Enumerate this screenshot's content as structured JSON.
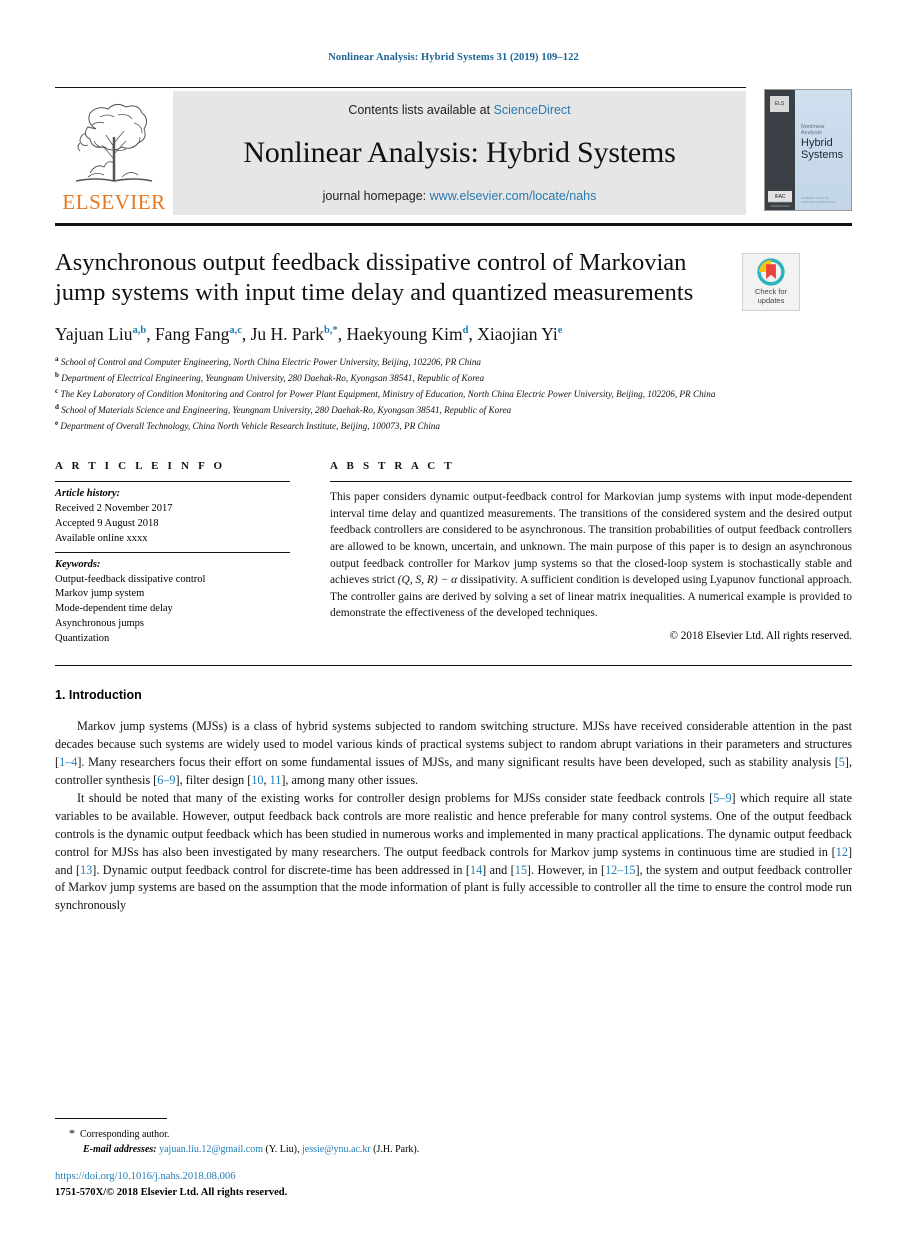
{
  "running_head": "Nonlinear Analysis: Hybrid Systems 31 (2019) 109–122",
  "masthead": {
    "publisher_word": "ELSEVIER",
    "contents_prefix": "Contents lists available at",
    "contents_link": "ScienceDirect",
    "journal_title": "Nonlinear Analysis: Hybrid Systems",
    "homepage_prefix": "journal homepage:",
    "homepage_link": "www.elsevier.com/locate/nahs",
    "cover": {
      "elsevier_mark": "ELS",
      "ifac_mark": "IFAC",
      "ifac_sub": "INTERNATIONAL FEDERATION",
      "superline": "Nonlinear Analysis",
      "title_line1": "Hybrid",
      "title_line2": "Systems",
      "bottom_note": "Available online at www.sciencedirect.com"
    }
  },
  "article": {
    "title": "Asynchronous output feedback dissipative control of Markovian jump systems with input time delay and quantized measurements",
    "crossmark_label_line1": "Check for",
    "crossmark_label_line2": "updates",
    "authors": [
      {
        "name": "Yajuan Liu",
        "marks": "a,b"
      },
      {
        "name": "Fang Fang",
        "marks": "a,c"
      },
      {
        "name": "Ju H. Park",
        "marks": "b,*"
      },
      {
        "name": "Haekyoung Kim",
        "marks": "d"
      },
      {
        "name": "Xiaojian Yi",
        "marks": "e"
      }
    ],
    "affiliations": [
      {
        "mark": "a",
        "text": "School of Control and Computer Engineering, North China Electric Power University, Beijing, 102206, PR China"
      },
      {
        "mark": "b",
        "text": "Department of Electrical Engineering, Yeungnam University, 280 Daehak-Ro, Kyongsan  38541, Republic of Korea"
      },
      {
        "mark": "c",
        "text": "The Key Laboratory of Condition Monitoring and Control for Power Plant Equipment, Ministry of Education, North China Electric Power University, Beijing, 102206, PR China"
      },
      {
        "mark": "d",
        "text": "School of Materials Science and Engineering, Yeungnam University, 280 Daehak-Ro, Kyongsan  38541, Republic of Korea"
      },
      {
        "mark": "e",
        "text": "Department of Overall Technology, China North Vehicle Research Institute, Beijing, 100073, PR China"
      }
    ]
  },
  "article_info": {
    "heading": "A R T I C L E   I N F O",
    "history_label": "Article history:",
    "history_lines": [
      "Received 2 November 2017",
      "Accepted 9 August 2018",
      "Available online xxxx"
    ],
    "keywords_label": "Keywords:",
    "keywords": [
      "Output-feedback dissipative control",
      "Markov jump system",
      "Mode-dependent time delay",
      "Asynchronous jumps",
      "Quantization"
    ]
  },
  "abstract": {
    "heading": "A B S T R A C T",
    "text_part1": "This paper considers dynamic output-feedback control for Markovian jump systems with input mode-dependent interval time delay and quantized measurements. The transitions of the considered system and the desired output feedback controllers are considered to be asynchronous. The transition probabilities of output feedback controllers are allowed to be known, uncertain, and unknown. The main purpose of this paper is to design an asynchronous output feedback controller for Markov jump systems so that the closed-loop system is stochastically stable and achieves strict ",
    "math_expr": "(Q, S, R) − α",
    "text_part2": " dissipativity. A sufficient condition is developed using Lyapunov functional approach. The controller gains are derived by solving a set of linear matrix inequalities. A numerical example is provided to demonstrate the effectiveness of the developed techniques.",
    "copyright": "© 2018 Elsevier Ltd. All rights reserved."
  },
  "introduction": {
    "heading": "1.  Introduction",
    "paragraph1_a": "Markov jump systems (MJSs) is a class of hybrid systems subjected to random switching structure. MJSs have received considerable attention in the past decades because such systems are widely used to model various kinds of practical systems subject to random abrupt variations in their parameters and structures [",
    "ref1": "1–4",
    "paragraph1_b": "]. Many researchers focus their effort on some fundamental issues of MJSs, and many significant results have been developed, such as stability analysis [",
    "ref2": "5",
    "paragraph1_c": "], controller synthesis [",
    "ref3": "6–9",
    "paragraph1_d": "], filter design [",
    "ref4": "10",
    "paragraph1_e": ", ",
    "ref5": "11",
    "paragraph1_f": "], among many other issues.",
    "paragraph2_a": "It should be noted that many of the existing works for controller design problems for MJSs consider state feedback controls [",
    "ref6": "5–9",
    "paragraph2_b": "] which require all state variables to be available. However, output feedback back controls are more realistic and hence preferable for many control systems. One of the output feedback controls is the dynamic output feedback which has been studied in numerous works and implemented in many practical applications. The dynamic output feedback control for MJSs has also been investigated by many researchers. The output feedback controls for Markov jump systems in continuous time are studied in [",
    "ref7": "12",
    "paragraph2_c": "] and [",
    "ref8": "13",
    "paragraph2_d": "]. Dynamic output feedback control for discrete-time has been addressed in [",
    "ref9": "14",
    "paragraph2_e": "] and [",
    "ref10": "15",
    "paragraph2_f": "]. However, in [",
    "ref11": "12–15",
    "paragraph2_g": "], the system and output feedback controller of Markov jump systems are based on the assumption that the mode information of plant is fully accessible to controller all the time to ensure the control mode run synchronously"
  },
  "footnotes": {
    "star": "*",
    "corresponding": "Corresponding author.",
    "email_label": "E-mail addresses:",
    "email1": "yajuan.liu.12@gmail.com",
    "email1_owner": "(Y. Liu),",
    "email2": "jessie@ynu.ac.kr",
    "email2_owner": "(J.H. Park).",
    "doi": "https://doi.org/10.1016/j.nahs.2018.08.006",
    "issn_line": "1751-570X/© 2018 Elsevier Ltd. All rights reserved."
  },
  "colors": {
    "link_blue": "#1f7cb4",
    "masthead_bg": "#e6e6e6",
    "elsevier_orange": "#e87722",
    "crossmark_yellow": "#f5c518",
    "crossmark_red": "#e8453c",
    "crossmark_teal": "#2bb3c0"
  }
}
